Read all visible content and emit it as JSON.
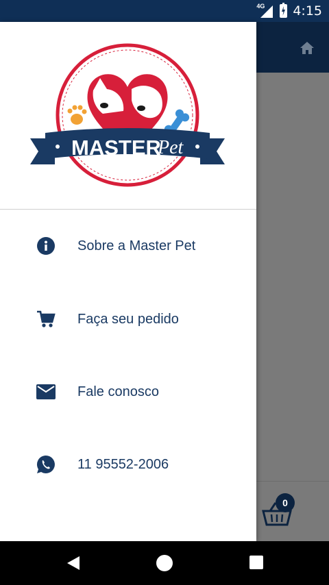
{
  "status_bar": {
    "network": "4G",
    "time": "4:15"
  },
  "app": {
    "cart_count": "0"
  },
  "drawer": {
    "logo": {
      "brand_main": "MASTER",
      "brand_script": "Pet"
    },
    "items": [
      {
        "label": "Sobre a Master Pet",
        "icon": "info-icon"
      },
      {
        "label": "Faça seu pedido",
        "icon": "cart-icon"
      },
      {
        "label": "Fale conosco",
        "icon": "mail-icon"
      },
      {
        "label": "11 95552-2006",
        "icon": "whatsapp-icon"
      }
    ]
  },
  "colors": {
    "navy": "#1a3a63",
    "red": "#d71f3a",
    "statusbar": "#0f2f56"
  }
}
